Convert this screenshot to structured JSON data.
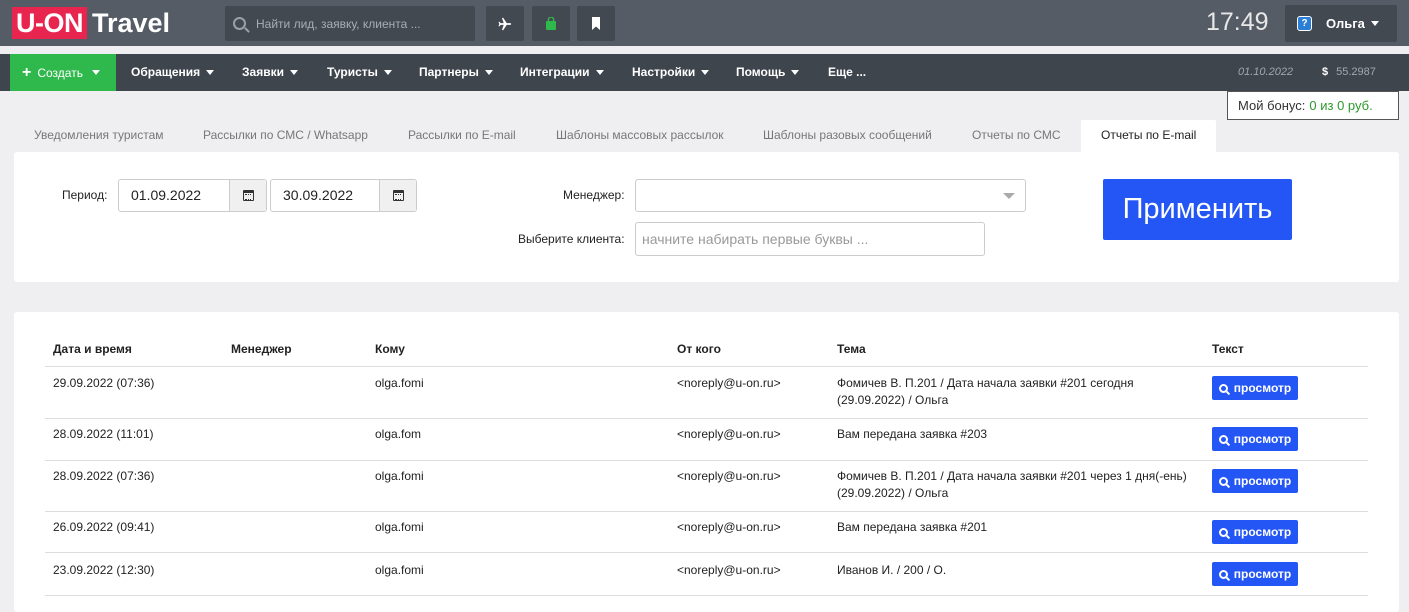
{
  "header": {
    "logo_part1": "U-ON",
    "logo_part2": "Travel",
    "search_placeholder": "Найти лид, заявку, клиента ...",
    "clock": "17:49",
    "user_name": "Ольга",
    "help_glyph": "?"
  },
  "nav": {
    "create_label": "Создать",
    "items": [
      "Обращения",
      "Заявки",
      "Туристы",
      "Партнеры",
      "Интеграции",
      "Настройки",
      "Помощь",
      "Еще ..."
    ],
    "date": "01.10.2022",
    "currency_symbol": "$",
    "rate": "55.2987"
  },
  "bonus": {
    "label": "Мой бонус:",
    "value": "0 из 0 руб."
  },
  "tabs": [
    "Уведомления туристам",
    "Рассылки по СМС / Whatsapp",
    "Рассылки по E-mail",
    "Шаблоны массовых рассылок",
    "Шаблоны разовых сообщений",
    "Отчеты по СМС",
    "Отчеты по E-mail"
  ],
  "active_tab": "Отчеты по E-mail",
  "filter": {
    "period_label": "Период:",
    "date_from": "01.09.2022",
    "date_to": "30.09.2022",
    "manager_label": "Менеджер:",
    "manager_value": "",
    "client_label": "Выберите клиента:",
    "client_placeholder": "начните набирать первые буквы ...",
    "apply_label": "Применить"
  },
  "table": {
    "columns": [
      "Дата и время",
      "Менеджер",
      "Кому",
      "От кого",
      "Тема",
      "Текст"
    ],
    "view_label": "просмотр",
    "rows": [
      {
        "datetime": "29.09.2022 (07:36)",
        "manager": "",
        "to": "olga.fomi",
        "from": "<noreply@u-on.ru>",
        "subject_1": "Фомичев В. П.201 / Дата начала заявки #201 сегодня",
        "subject_2": "(29.09.2022) / Ольга"
      },
      {
        "datetime": "28.09.2022 (11:01)",
        "manager": "",
        "to": "olga.fom",
        "from": "<noreply@u-on.ru>",
        "subject_1": "Вам передана заявка #203",
        "subject_2": ""
      },
      {
        "datetime": "28.09.2022 (07:36)",
        "manager": "",
        "to": "olga.fomi",
        "from": "<noreply@u-on.ru>",
        "subject_1": "Фомичев В. П.201 / Дата начала заявки #201 через 1 дня(-ень)",
        "subject_2": "(29.09.2022) / Ольга"
      },
      {
        "datetime": "26.09.2022 (09:41)",
        "manager": "",
        "to": "olga.fomi",
        "from": "<noreply@u-on.ru>",
        "subject_1": "Вам передана заявка #201",
        "subject_2": ""
      },
      {
        "datetime": "23.09.2022 (12:30)",
        "manager": "",
        "to": "olga.fomi",
        "from": "<noreply@u-on.ru>",
        "subject_1": "Иванов И. / 200 / О.",
        "subject_2": ""
      }
    ]
  }
}
